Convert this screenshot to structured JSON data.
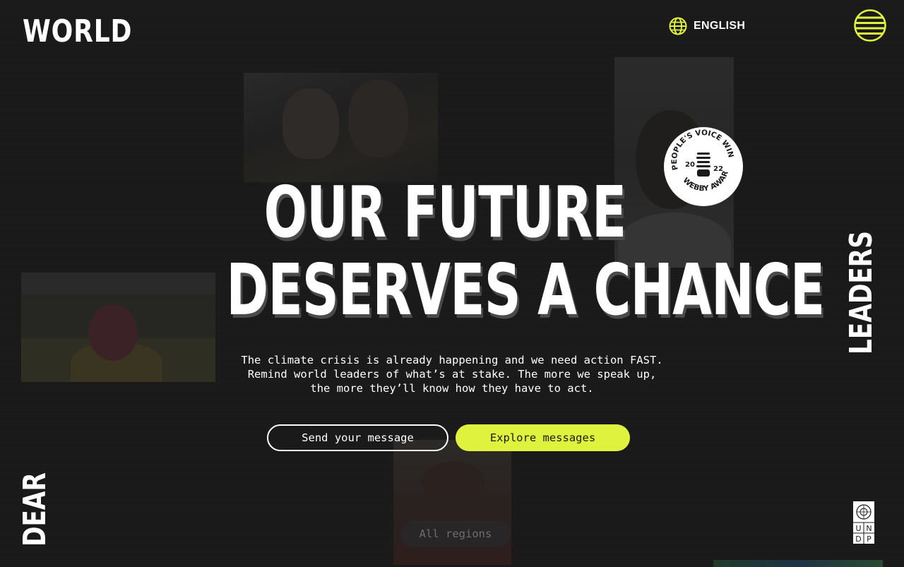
{
  "header": {
    "logo_text": "WORLD",
    "language_label": "ENGLISH",
    "accent_color": "#dff23d"
  },
  "hero": {
    "headline_line1": "OUR FUTURE",
    "headline_line2": "DESERVES A CHANCE",
    "description": "The climate crisis is already happening and we need action FAST. Remind world leaders of what’s at stake. The more we speak up, the more they’ll know how they have to act.",
    "send_button": "Send your message",
    "explore_button": "Explore messages"
  },
  "side_words": {
    "right": "LEADERS",
    "left": "DEAR"
  },
  "badge": {
    "top_text": "PEOPLE'S VOICE WINNER",
    "bottom_text": "WEBBY AWARDS",
    "year_left": "20",
    "year_right": "22"
  },
  "filter": {
    "regions_label": "All regions"
  },
  "undp_logo": {
    "letters": [
      "U",
      "N",
      "D",
      "P"
    ]
  },
  "icons": {
    "language": "globe-icon",
    "menu": "striped-circle-menu-icon"
  }
}
